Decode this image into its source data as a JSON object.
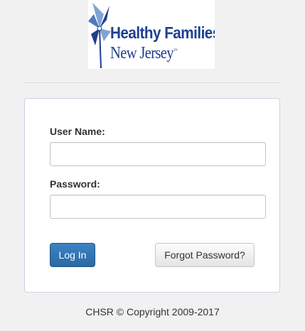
{
  "logo": {
    "line1": "Healthy Families",
    "line2": "New Jersey",
    "trademark": "™",
    "icon": "pinwheel-icon",
    "brand_color": "#1f3f8f"
  },
  "login_form": {
    "username_label": "User Name:",
    "username_value": "",
    "username_placeholder": "",
    "password_label": "Password:",
    "password_value": "",
    "password_placeholder": "",
    "login_button": "Log In",
    "forgot_password_button": "Forgot Password?",
    "primary_color": "#2f72b2"
  },
  "footer": {
    "copyright": "CHSR © Copyright 2009-2017"
  }
}
